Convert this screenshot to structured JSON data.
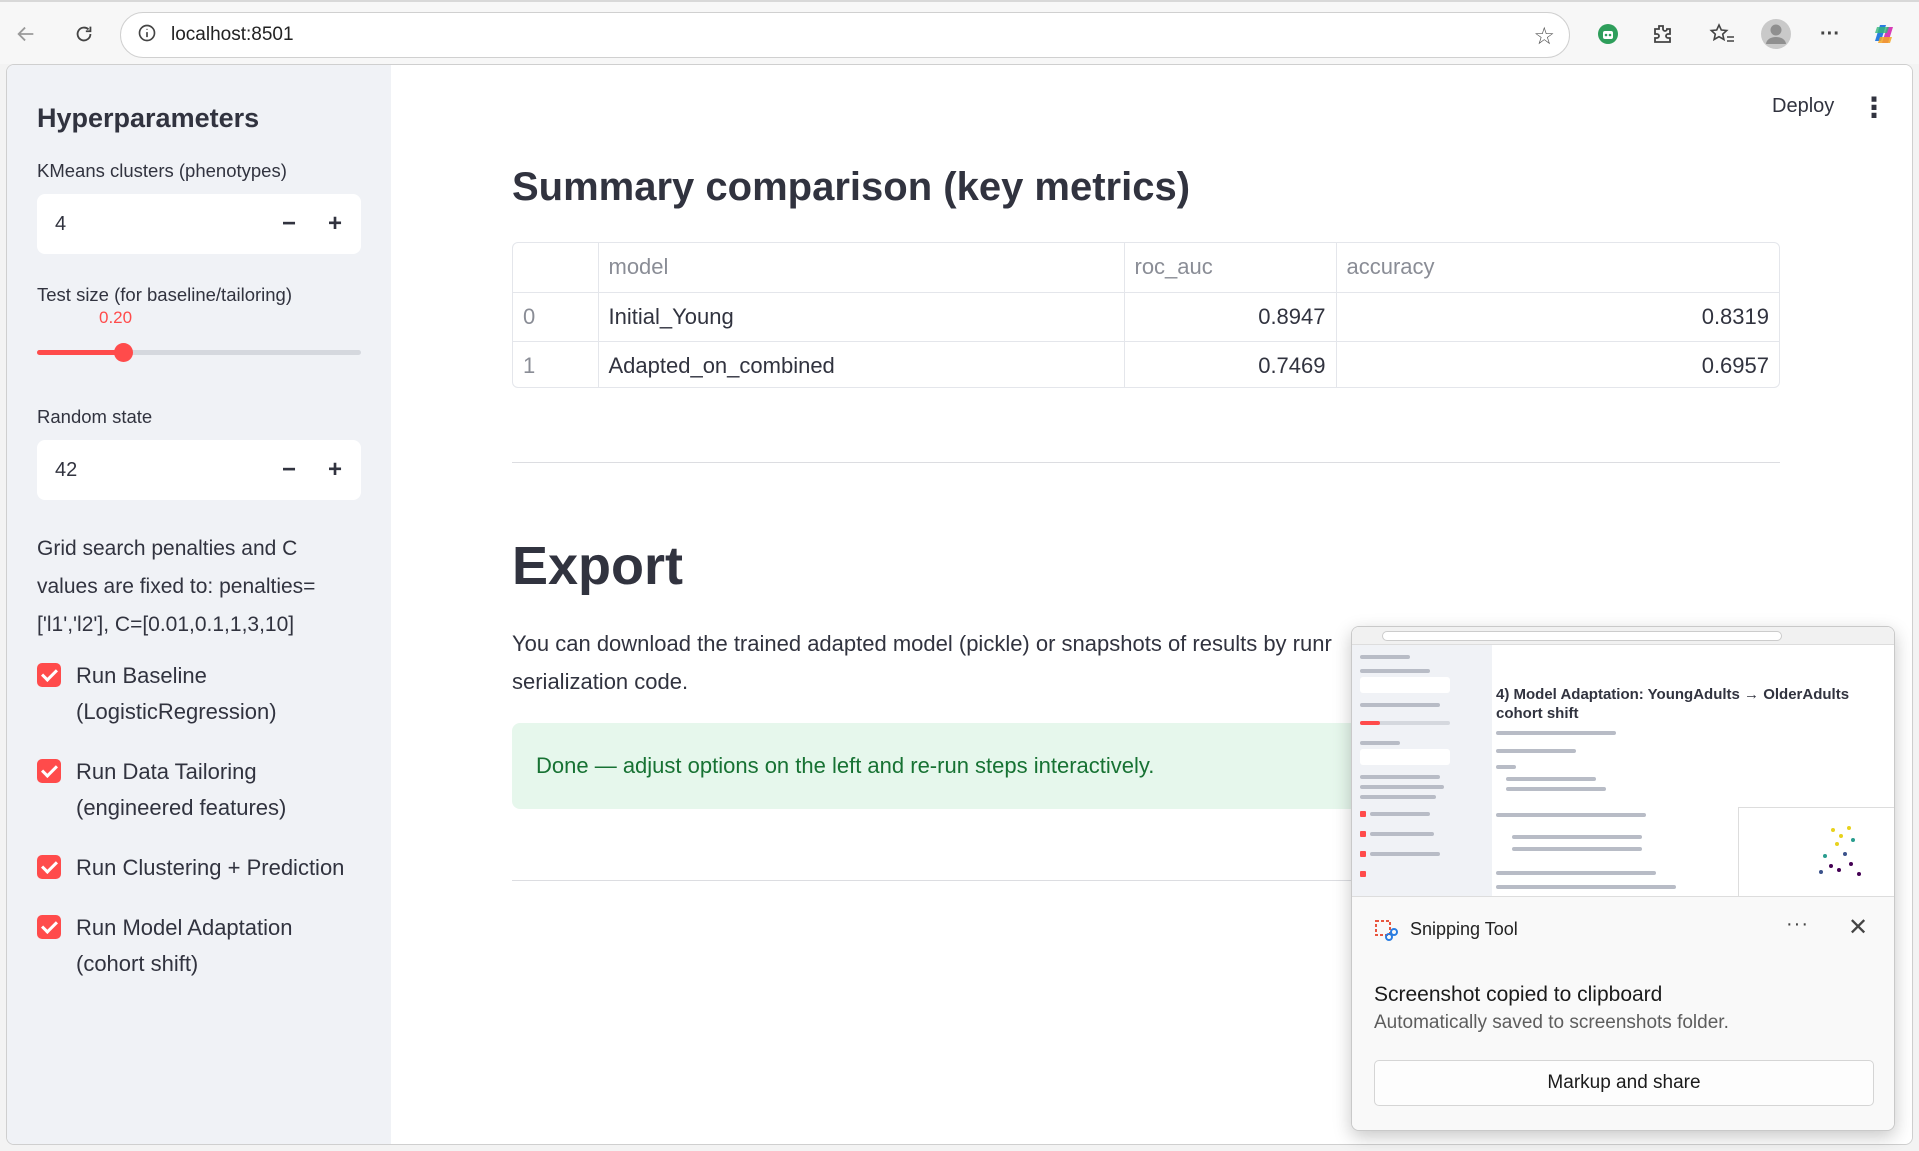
{
  "browser": {
    "url": "localhost:8501"
  },
  "sidebar": {
    "title": "Hyperparameters",
    "kmeans_label": "KMeans clusters (phenotypes)",
    "kmeans_value": "4",
    "test_size_label": "Test size (for baseline/tailoring)",
    "test_size_value": "0.20",
    "test_size_fraction": 0.2,
    "random_state_label": "Random state",
    "random_state_value": "42",
    "grid_note": "Grid search penalties and C values are fixed to: penalties=['l1','l2'], C=[0.01,0.1,1,3,10]",
    "checkboxes": [
      {
        "label": "Run Baseline (LogisticRegression)",
        "checked": true
      },
      {
        "label": "Run Data Tailoring (engineered features)",
        "checked": true
      },
      {
        "label": "Run Clustering + Prediction",
        "checked": true
      },
      {
        "label": "Run Model Adaptation (cohort shift)",
        "checked": true
      }
    ]
  },
  "header": {
    "deploy_label": "Deploy",
    "menu_icon": "⋮"
  },
  "main": {
    "summary_title": "Summary comparison (key metrics)",
    "table": {
      "headers": [
        "",
        "model",
        "roc_auc",
        "accuracy"
      ],
      "rows": [
        {
          "index": "0",
          "model": "Initial_Young",
          "roc_auc": "0.8947",
          "accuracy": "0.8319"
        },
        {
          "index": "1",
          "model": "Adapted_on_combined",
          "roc_auc": "0.7469",
          "accuracy": "0.6957"
        }
      ]
    },
    "export_title": "Export",
    "export_text": "You can download the trained adapted model (pickle) or snapshots of results by runr serialization code.",
    "success_text": "Done — adjust options on the left and re-run steps interactively."
  },
  "toast": {
    "app_name": "Snipping Tool",
    "more_icon": "···",
    "close_icon": "✕",
    "message": "Screenshot copied to clipboard",
    "submessage": "Automatically saved to screenshots folder.",
    "button_label": "Markup and share",
    "thumbnail_title": "4) Model Adaptation: YoungAdults → OlderAdults cohort shift"
  },
  "colors": {
    "accent": "#ff4b4b",
    "sidebar_bg": "#f0f2f6",
    "success_bg": "#e6f7ec",
    "success_text": "#177233"
  }
}
